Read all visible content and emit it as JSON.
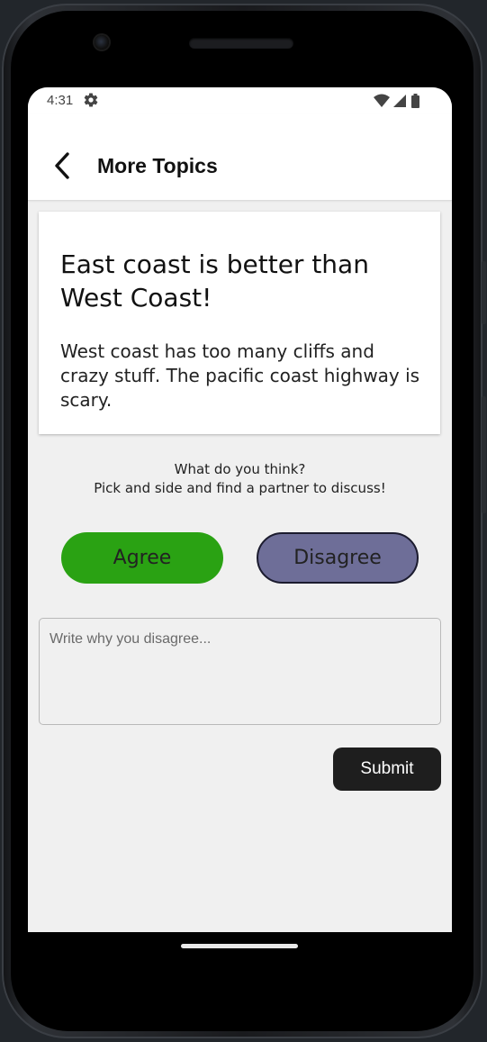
{
  "status_bar": {
    "time": "4:31",
    "settings_icon": "gear-icon",
    "right_icons": [
      "wifi-icon",
      "cell-signal-icon",
      "battery-icon"
    ]
  },
  "app_bar": {
    "back_icon": "chevron-left-icon",
    "title": "More Topics"
  },
  "topic": {
    "title": "East coast is better than West Coast!",
    "body": "West coast has too many cliffs and crazy stuff.  The pacific coast highway is scary."
  },
  "prompt": {
    "line1": "What do you think?",
    "line2": "Pick and side and find a partner to discuss!"
  },
  "choices": {
    "agree_label": "Agree",
    "disagree_label": "Disagree",
    "selected": "Disagree"
  },
  "reason_input": {
    "placeholder": "Write why you disagree...",
    "value": ""
  },
  "submit_label": "Submit",
  "colors": {
    "agree": "#2aa213",
    "disagree": "#6e6e98",
    "submit": "#1e1e1e",
    "screen_background": "#f0f0f0"
  }
}
